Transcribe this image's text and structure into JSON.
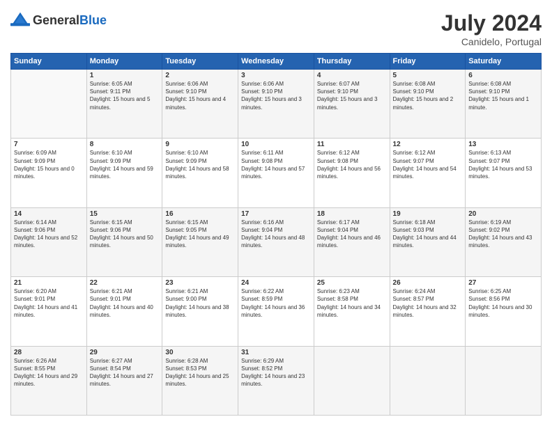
{
  "header": {
    "logo_general": "General",
    "logo_blue": "Blue",
    "month_year": "July 2024",
    "location": "Canidelo, Portugal"
  },
  "days_of_week": [
    "Sunday",
    "Monday",
    "Tuesday",
    "Wednesday",
    "Thursday",
    "Friday",
    "Saturday"
  ],
  "weeks": [
    [
      {
        "day": "",
        "sunrise": "",
        "sunset": "",
        "daylight": ""
      },
      {
        "day": "1",
        "sunrise": "Sunrise: 6:05 AM",
        "sunset": "Sunset: 9:11 PM",
        "daylight": "Daylight: 15 hours and 5 minutes."
      },
      {
        "day": "2",
        "sunrise": "Sunrise: 6:06 AM",
        "sunset": "Sunset: 9:10 PM",
        "daylight": "Daylight: 15 hours and 4 minutes."
      },
      {
        "day": "3",
        "sunrise": "Sunrise: 6:06 AM",
        "sunset": "Sunset: 9:10 PM",
        "daylight": "Daylight: 15 hours and 3 minutes."
      },
      {
        "day": "4",
        "sunrise": "Sunrise: 6:07 AM",
        "sunset": "Sunset: 9:10 PM",
        "daylight": "Daylight: 15 hours and 3 minutes."
      },
      {
        "day": "5",
        "sunrise": "Sunrise: 6:08 AM",
        "sunset": "Sunset: 9:10 PM",
        "daylight": "Daylight: 15 hours and 2 minutes."
      },
      {
        "day": "6",
        "sunrise": "Sunrise: 6:08 AM",
        "sunset": "Sunset: 9:10 PM",
        "daylight": "Daylight: 15 hours and 1 minute."
      }
    ],
    [
      {
        "day": "7",
        "sunrise": "Sunrise: 6:09 AM",
        "sunset": "Sunset: 9:09 PM",
        "daylight": "Daylight: 15 hours and 0 minutes."
      },
      {
        "day": "8",
        "sunrise": "Sunrise: 6:10 AM",
        "sunset": "Sunset: 9:09 PM",
        "daylight": "Daylight: 14 hours and 59 minutes."
      },
      {
        "day": "9",
        "sunrise": "Sunrise: 6:10 AM",
        "sunset": "Sunset: 9:09 PM",
        "daylight": "Daylight: 14 hours and 58 minutes."
      },
      {
        "day": "10",
        "sunrise": "Sunrise: 6:11 AM",
        "sunset": "Sunset: 9:08 PM",
        "daylight": "Daylight: 14 hours and 57 minutes."
      },
      {
        "day": "11",
        "sunrise": "Sunrise: 6:12 AM",
        "sunset": "Sunset: 9:08 PM",
        "daylight": "Daylight: 14 hours and 56 minutes."
      },
      {
        "day": "12",
        "sunrise": "Sunrise: 6:12 AM",
        "sunset": "Sunset: 9:07 PM",
        "daylight": "Daylight: 14 hours and 54 minutes."
      },
      {
        "day": "13",
        "sunrise": "Sunrise: 6:13 AM",
        "sunset": "Sunset: 9:07 PM",
        "daylight": "Daylight: 14 hours and 53 minutes."
      }
    ],
    [
      {
        "day": "14",
        "sunrise": "Sunrise: 6:14 AM",
        "sunset": "Sunset: 9:06 PM",
        "daylight": "Daylight: 14 hours and 52 minutes."
      },
      {
        "day": "15",
        "sunrise": "Sunrise: 6:15 AM",
        "sunset": "Sunset: 9:06 PM",
        "daylight": "Daylight: 14 hours and 50 minutes."
      },
      {
        "day": "16",
        "sunrise": "Sunrise: 6:15 AM",
        "sunset": "Sunset: 9:05 PM",
        "daylight": "Daylight: 14 hours and 49 minutes."
      },
      {
        "day": "17",
        "sunrise": "Sunrise: 6:16 AM",
        "sunset": "Sunset: 9:04 PM",
        "daylight": "Daylight: 14 hours and 48 minutes."
      },
      {
        "day": "18",
        "sunrise": "Sunrise: 6:17 AM",
        "sunset": "Sunset: 9:04 PM",
        "daylight": "Daylight: 14 hours and 46 minutes."
      },
      {
        "day": "19",
        "sunrise": "Sunrise: 6:18 AM",
        "sunset": "Sunset: 9:03 PM",
        "daylight": "Daylight: 14 hours and 44 minutes."
      },
      {
        "day": "20",
        "sunrise": "Sunrise: 6:19 AM",
        "sunset": "Sunset: 9:02 PM",
        "daylight": "Daylight: 14 hours and 43 minutes."
      }
    ],
    [
      {
        "day": "21",
        "sunrise": "Sunrise: 6:20 AM",
        "sunset": "Sunset: 9:01 PM",
        "daylight": "Daylight: 14 hours and 41 minutes."
      },
      {
        "day": "22",
        "sunrise": "Sunrise: 6:21 AM",
        "sunset": "Sunset: 9:01 PM",
        "daylight": "Daylight: 14 hours and 40 minutes."
      },
      {
        "day": "23",
        "sunrise": "Sunrise: 6:21 AM",
        "sunset": "Sunset: 9:00 PM",
        "daylight": "Daylight: 14 hours and 38 minutes."
      },
      {
        "day": "24",
        "sunrise": "Sunrise: 6:22 AM",
        "sunset": "Sunset: 8:59 PM",
        "daylight": "Daylight: 14 hours and 36 minutes."
      },
      {
        "day": "25",
        "sunrise": "Sunrise: 6:23 AM",
        "sunset": "Sunset: 8:58 PM",
        "daylight": "Daylight: 14 hours and 34 minutes."
      },
      {
        "day": "26",
        "sunrise": "Sunrise: 6:24 AM",
        "sunset": "Sunset: 8:57 PM",
        "daylight": "Daylight: 14 hours and 32 minutes."
      },
      {
        "day": "27",
        "sunrise": "Sunrise: 6:25 AM",
        "sunset": "Sunset: 8:56 PM",
        "daylight": "Daylight: 14 hours and 30 minutes."
      }
    ],
    [
      {
        "day": "28",
        "sunrise": "Sunrise: 6:26 AM",
        "sunset": "Sunset: 8:55 PM",
        "daylight": "Daylight: 14 hours and 29 minutes."
      },
      {
        "day": "29",
        "sunrise": "Sunrise: 6:27 AM",
        "sunset": "Sunset: 8:54 PM",
        "daylight": "Daylight: 14 hours and 27 minutes."
      },
      {
        "day": "30",
        "sunrise": "Sunrise: 6:28 AM",
        "sunset": "Sunset: 8:53 PM",
        "daylight": "Daylight: 14 hours and 25 minutes."
      },
      {
        "day": "31",
        "sunrise": "Sunrise: 6:29 AM",
        "sunset": "Sunset: 8:52 PM",
        "daylight": "Daylight: 14 hours and 23 minutes."
      },
      {
        "day": "",
        "sunrise": "",
        "sunset": "",
        "daylight": ""
      },
      {
        "day": "",
        "sunrise": "",
        "sunset": "",
        "daylight": ""
      },
      {
        "day": "",
        "sunrise": "",
        "sunset": "",
        "daylight": ""
      }
    ]
  ]
}
